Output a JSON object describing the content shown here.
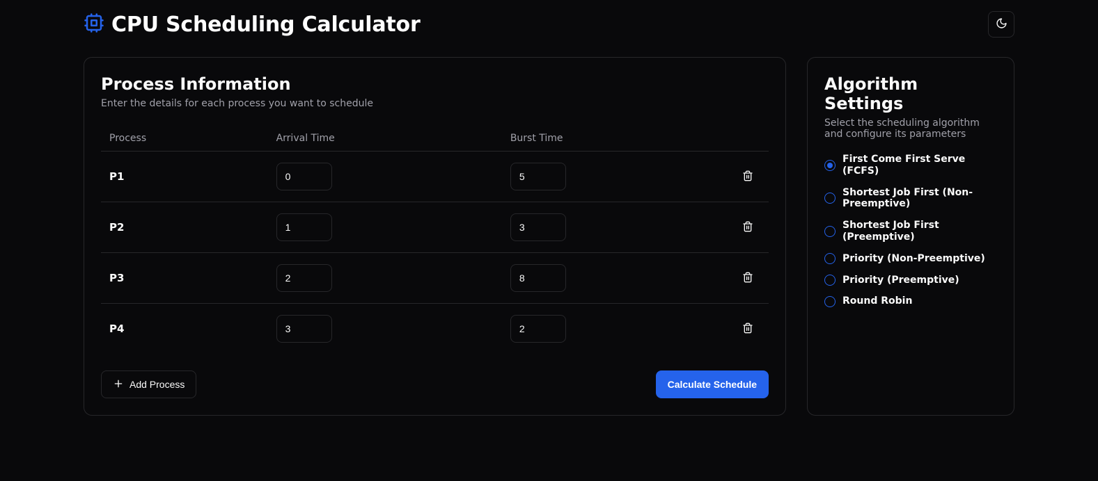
{
  "header": {
    "title": "CPU Scheduling Calculator"
  },
  "processCard": {
    "title": "Process Information",
    "description": "Enter the details for each process you want to schedule",
    "columns": {
      "process": "Process",
      "arrival": "Arrival Time",
      "burst": "Burst Time"
    },
    "rows": [
      {
        "name": "P1",
        "arrival": "0",
        "burst": "5"
      },
      {
        "name": "P2",
        "arrival": "1",
        "burst": "3"
      },
      {
        "name": "P3",
        "arrival": "2",
        "burst": "8"
      },
      {
        "name": "P4",
        "arrival": "3",
        "burst": "2"
      }
    ],
    "addLabel": "Add Process",
    "calculateLabel": "Calculate Schedule"
  },
  "algoCard": {
    "title": "Algorithm Settings",
    "description": "Select the scheduling algorithm and configure its parameters",
    "options": [
      {
        "label": "First Come First Serve (FCFS)",
        "selected": true
      },
      {
        "label": "Shortest Job First (Non-Preemptive)",
        "selected": false
      },
      {
        "label": "Shortest Job First (Preemptive)",
        "selected": false
      },
      {
        "label": "Priority (Non-Preemptive)",
        "selected": false
      },
      {
        "label": "Priority (Preemptive)",
        "selected": false
      },
      {
        "label": "Round Robin",
        "selected": false
      }
    ]
  },
  "colors": {
    "accent": "#2563eb"
  }
}
